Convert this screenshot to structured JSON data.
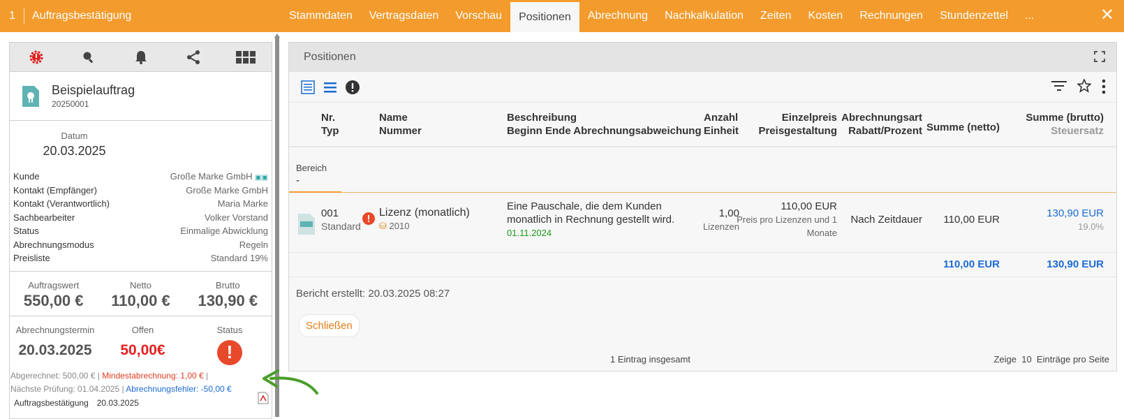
{
  "topbar": {
    "number": "1",
    "title": "Auftragsbestätigung",
    "tabs": [
      "Stammdaten",
      "Vertragsdaten",
      "Vorschau",
      "Positionen",
      "Abrechnung",
      "Nachkalkulation",
      "Zeiten",
      "Kosten",
      "Rechnungen",
      "Stundenzettel",
      "..."
    ],
    "active_tab": "Positionen",
    "close_icon": "close-icon",
    "accent_color": "#f39b2c"
  },
  "left": {
    "toolbar_icons": [
      "alert-gear-icon",
      "search-icon",
      "bell-icon",
      "share-icon",
      "grid-icon"
    ],
    "order": {
      "name": "Beispielauftrag",
      "number": "20250001"
    },
    "date": {
      "label": "Datum",
      "value": "20.03.2025"
    },
    "details": [
      {
        "key": "Kunde",
        "value": "Große Marke GmbH"
      },
      {
        "key": "Kontakt (Empfänger)",
        "value": "Große Marke GmbH"
      },
      {
        "key": "Kontakt (Verantwortlich)",
        "value": "Maria Marke"
      },
      {
        "key": "Sachbearbeiter",
        "value": "Volker Vorstand"
      },
      {
        "key": "Status",
        "value": "Einmalige Abwicklung"
      },
      {
        "key": "Abrechnungsmodus",
        "value": "Regeln"
      },
      {
        "key": "Preisliste",
        "value": "Standard 19%"
      }
    ],
    "totals": [
      {
        "label": "Auftragswert",
        "value": "550,00 €"
      },
      {
        "label": "Netto",
        "value": "110,00 €"
      },
      {
        "label": "Brutto",
        "value": "130,90 €"
      }
    ],
    "billing": {
      "date_label": "Abrechnungstermin",
      "date_value": "20.03.2025",
      "open_label": "Offen",
      "open_value": "50,00€",
      "status_label": "Status",
      "status_symbol": "!"
    },
    "notes": {
      "billed": "Abgerechnet: 500,00 €",
      "minimum": "Mindestabrechnung: 1,00  €",
      "next_check": "Nächste Prüfung: 01.04.2025",
      "error": "Abrechnungsfehler: -50,00 €"
    },
    "footer_doc": {
      "name": "Auftragsbestätigung",
      "date": "20.03.2025"
    }
  },
  "right": {
    "title": "Positionen",
    "headers": {
      "nr": "Nr.",
      "typ": "Typ",
      "name": "Name",
      "nummer": "Nummer",
      "beschreibung": "Beschreibung",
      "beginn": "Beginn Ende Abrechnungsabweichung",
      "anzahl": "Anzahl",
      "einheit": "Einheit",
      "einzelpreis": "Einzelpreis",
      "preisgestaltung": "Preisgestaltung",
      "abrechnungsart": "Abrechnungsart",
      "rabatt": "Rabatt/Prozent",
      "summe_netto": "Summe (netto)",
      "summe_brutto": "Summe (brutto)",
      "steuersatz": "Steuersatz"
    },
    "area": {
      "label": "Bereich",
      "value": "-"
    },
    "position": {
      "nr": "001",
      "typ": "Standard",
      "name": "Lizenz (monatlich)",
      "nummer": "2010",
      "beschreibung": "Eine Pauschale, die dem Kunden monatlich in Rechnung gestellt wird.",
      "datum": "01.11.2024",
      "anzahl": "1,00",
      "einheit": "Lizenzen",
      "einzelpreis": "110,00 EUR",
      "preisgestaltung": "Preis pro Lizenzen und 1 Monate",
      "abrechnungsart": "Nach Zeitdauer",
      "summe_netto": "110,00 EUR",
      "summe_brutto": "130,90 EUR",
      "steuersatz": "19.0%"
    },
    "sum": {
      "netto": "110,00 EUR",
      "brutto": "130,90 EUR"
    },
    "report": "Bericht erstellt: 20.03.2025 08:27",
    "close_button": "Schließen",
    "pager": {
      "total": "1 Eintrag insgesamt",
      "show": "Zeige",
      "count": "10",
      "per_page": "Einträge pro Seite"
    }
  }
}
